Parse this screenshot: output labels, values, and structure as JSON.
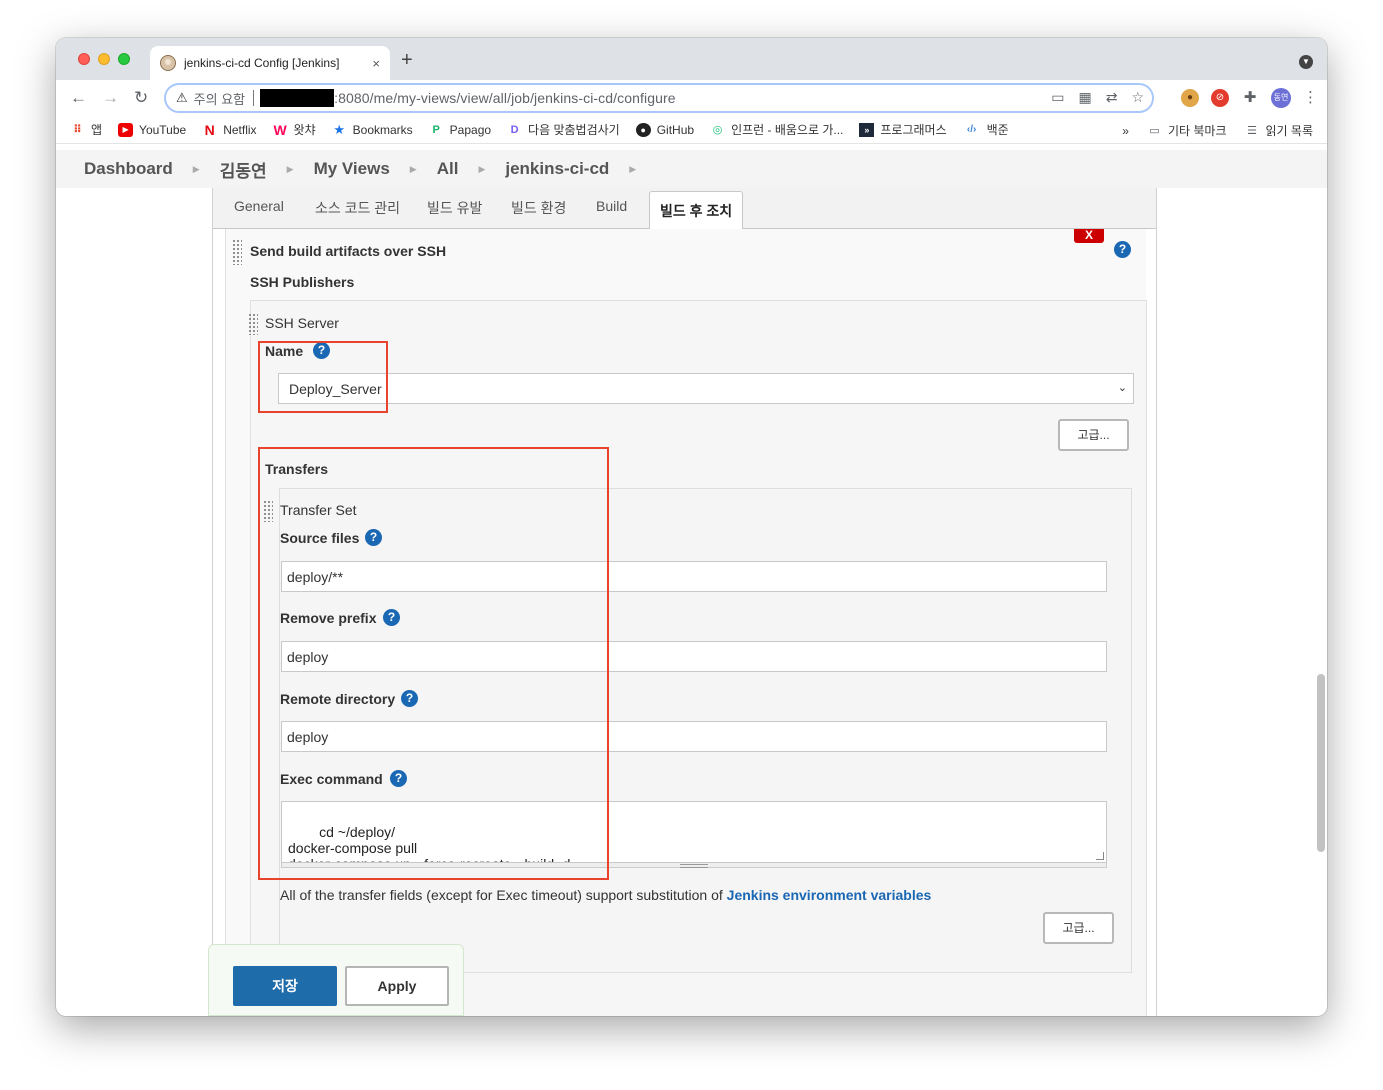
{
  "browser": {
    "tab_title": "jenkins-ci-cd Config [Jenkins]",
    "tab_close": "×",
    "new_tab": "+",
    "security_label": "주의 요함",
    "url_suffix": ":8080/me/my-views/view/all/job/jenkins-ci-cd/configure",
    "profile_badge": "동연",
    "bookmarks": [
      {
        "label": "앱",
        "icon": "apps-grid-icon"
      },
      {
        "label": "YouTube",
        "icon": "youtube-icon"
      },
      {
        "label": "Netflix",
        "icon": "netflix-icon"
      },
      {
        "label": "왓챠",
        "icon": "watcha-icon"
      },
      {
        "label": "Bookmarks",
        "icon": "star-icon"
      },
      {
        "label": "Papago",
        "icon": "papago-icon"
      },
      {
        "label": "다음 맞춤법검사기",
        "icon": "daum-icon"
      },
      {
        "label": "GitHub",
        "icon": "github-icon"
      },
      {
        "label": "인프런 - 배움으로 가...",
        "icon": "inflearn-icon"
      },
      {
        "label": "프로그래머스",
        "icon": "programmers-icon"
      },
      {
        "label": "백준",
        "icon": "code-icon"
      }
    ],
    "bookmarks_more": "»",
    "other_bookmarks": "기타 북마크",
    "reading_list": "읽기 목록"
  },
  "breadcrumb": [
    "Dashboard",
    "김동연",
    "My Views",
    "All",
    "jenkins-ci-cd"
  ],
  "config_tabs": [
    "General",
    "소스 코드 관리",
    "빌드 유발",
    "빌드 환경",
    "Build",
    "빌드 후 조치"
  ],
  "active_tab": "빌드 후 조치",
  "section": {
    "title": "Send build artifacts over SSH",
    "delete_label": "X",
    "publishers_label": "SSH Publishers",
    "server_label": "SSH Server",
    "name_label": "Name",
    "name_value": "Deploy_Server",
    "advanced_label": "고급...",
    "transfers_label": "Transfers",
    "transfer_set_label": "Transfer Set",
    "source_files_label": "Source files",
    "source_files_value": "deploy/**",
    "remove_prefix_label": "Remove prefix",
    "remove_prefix_value": "deploy",
    "remote_directory_label": "Remote directory",
    "remote_directory_value": "deploy",
    "exec_command_label": "Exec command",
    "exec_command_value": "cd ~/deploy/\ndocker-compose pull\ndocker-compose up --force-recreate --build -d",
    "note_text": "All of the transfer fields (except for Exec timeout) support substitution of ",
    "note_link": "Jenkins environment variables",
    "advanced_label_2": "고급..."
  },
  "actions": {
    "save_label": "저장",
    "apply_label": "Apply"
  },
  "colors": {
    "accent": "#1f6cab",
    "link": "#1a67b4",
    "annotation_red": "#e8432c",
    "delete_red": "#cc0000"
  }
}
